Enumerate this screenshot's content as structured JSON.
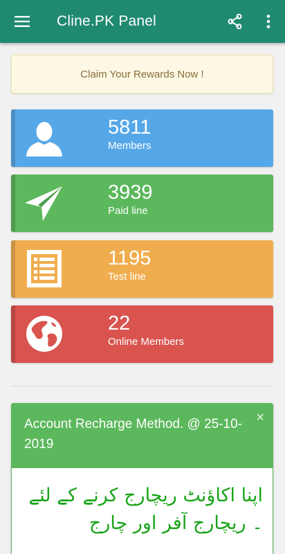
{
  "appbar": {
    "title": "Cline.PK Panel",
    "background": "#1f8a70",
    "icons": [
      "menu-icon",
      "share-icon",
      "more-vert-icon"
    ]
  },
  "notice": {
    "text": "Claim Your Rewards Now !"
  },
  "stats": [
    {
      "value": "5811",
      "label": "Members",
      "color": "#56a7e7",
      "icon": "user-icon"
    },
    {
      "value": "3939",
      "label": "Paid line",
      "color": "#5cb85c",
      "icon": "paper-plane-icon"
    },
    {
      "value": "1195",
      "label": "Test line",
      "color": "#f0ad4e",
      "icon": "list-icon"
    },
    {
      "value": "22",
      "label": "Online Members",
      "color": "#d9534f",
      "icon": "globe-icon"
    }
  ],
  "panel": {
    "title": "Account Recharge Method. @ 25-10-2019",
    "close_label": "×",
    "body": "اپنا اکاؤنٹ ریچارج کرنے کے لئے ۔ ریچارج آفر اور چارج",
    "header_color": "#5cb85c",
    "text_color": "#19a419"
  }
}
